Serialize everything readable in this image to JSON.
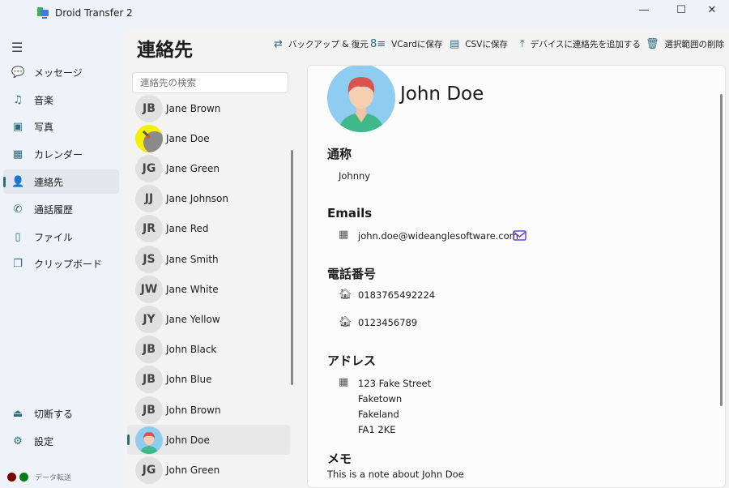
{
  "app": {
    "title": "Droid Transfer 2"
  },
  "window": {
    "minimize": "—",
    "maximize": "☐",
    "close": "✕"
  },
  "sidebar": {
    "items": [
      {
        "label": "メッセージ",
        "icon": "message-icon",
        "glyph": "💬"
      },
      {
        "label": "音楽",
        "icon": "music-icon",
        "glyph": "♫"
      },
      {
        "label": "写真",
        "icon": "photo-icon",
        "glyph": "▣"
      },
      {
        "label": "カレンダー",
        "icon": "calendar-icon",
        "glyph": "▦"
      },
      {
        "label": "連絡先",
        "icon": "contact-icon",
        "glyph": "👤",
        "active": true
      },
      {
        "label": "通話履歴",
        "icon": "phone-icon",
        "glyph": "✆"
      },
      {
        "label": "ファイル",
        "icon": "file-icon",
        "glyph": "▯"
      },
      {
        "label": "クリップボード",
        "icon": "clipboard-icon",
        "glyph": "❐"
      }
    ],
    "bottom": [
      {
        "label": "切断する",
        "icon": "eject-icon",
        "glyph": "⏏"
      },
      {
        "label": "設定",
        "icon": "gear-icon",
        "glyph": "⚙"
      }
    ],
    "status": {
      "label": "データ転送",
      "colors": [
        "#7a0000",
        "#0a7a14"
      ]
    }
  },
  "page": {
    "title": "連絡先"
  },
  "toolbar": [
    {
      "label": "バックアップ & 復元",
      "icon": "backup-restore-icon",
      "glyph": "⇄"
    },
    {
      "label": "VCardに保存",
      "icon": "vcard-icon",
      "glyph": "8≡"
    },
    {
      "label": "CSVに保存",
      "icon": "csv-icon",
      "glyph": "▤"
    },
    {
      "label": "デバイスに連絡先を追加する",
      "icon": "upload-icon",
      "glyph": "⤒"
    },
    {
      "label": "選択範囲の削除",
      "icon": "trash-icon",
      "glyph": "🗑"
    }
  ],
  "search": {
    "placeholder": "連絡先の検索"
  },
  "contacts": [
    {
      "initials": "JB",
      "name": "Jane Brown"
    },
    {
      "initials": "",
      "name": "Jane Doe",
      "photo": "fingerprint"
    },
    {
      "initials": "JG",
      "name": "Jane Green"
    },
    {
      "initials": "JJ",
      "name": "Jane Johnson"
    },
    {
      "initials": "JR",
      "name": "Jane Red"
    },
    {
      "initials": "JS",
      "name": "Jane Smith"
    },
    {
      "initials": "JW",
      "name": "Jane White"
    },
    {
      "initials": "JY",
      "name": "Jane Yellow"
    },
    {
      "initials": "JB",
      "name": "John Black"
    },
    {
      "initials": "JB",
      "name": "John Blue"
    },
    {
      "initials": "JB",
      "name": "John Brown"
    },
    {
      "initials": "",
      "name": "John Doe",
      "photo": "avatar",
      "selected": true
    },
    {
      "initials": "JG",
      "name": "John Green"
    }
  ],
  "detail": {
    "name": "John Doe",
    "nickname_label": "通称",
    "nickname": "Johnny",
    "emails_label": "Emails",
    "email": "john.doe@wideanglesoftware.com",
    "phones_label": "電話番号",
    "phones": [
      "0183765492224",
      "0123456789"
    ],
    "address_label": "アドレス",
    "address": [
      "123 Fake Street",
      "Faketown",
      "Fakeland",
      "FA1 2KE"
    ],
    "memo_label": "メモ",
    "memo": "This is a note about John Doe",
    "accent": "#6b3fd6"
  }
}
